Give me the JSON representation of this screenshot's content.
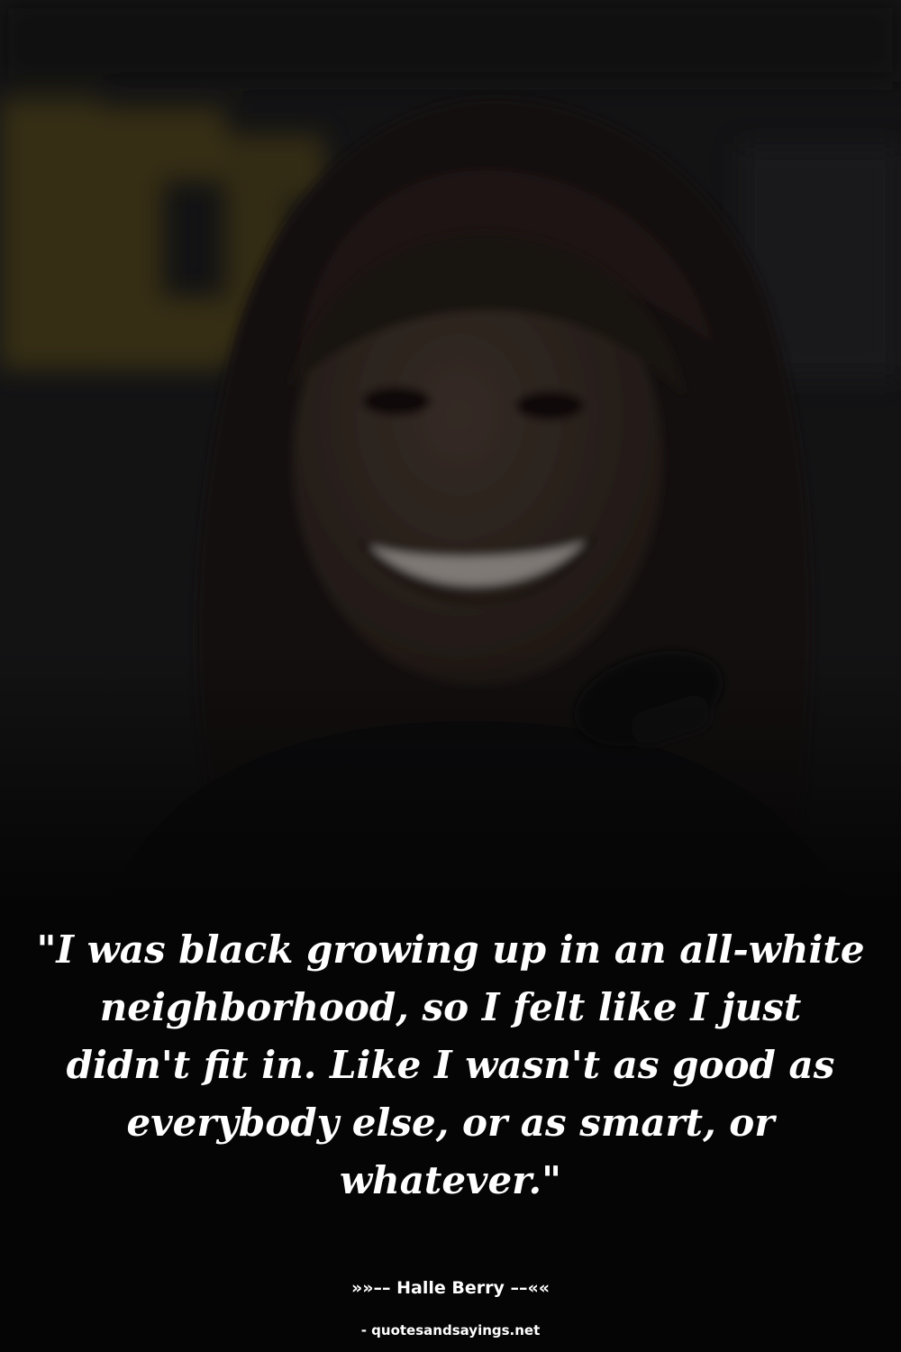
{
  "photo": {
    "subject": "smiling woman with dark hair at a microphone",
    "overlay_color": "#000000",
    "background_accent": "#6b5a1e"
  },
  "quote": {
    "text": "\"I was black growing up in an all-white neighborhood, so I felt like I just didn't fit in. Like I wasn't as good as everybody else, or as smart, or whatever.\""
  },
  "attribution": {
    "text": "»»–– Halle Berry ––««"
  },
  "source": {
    "text": "- quotesandsayings.net"
  },
  "colors": {
    "background": "#050505",
    "text": "#ffffff"
  }
}
